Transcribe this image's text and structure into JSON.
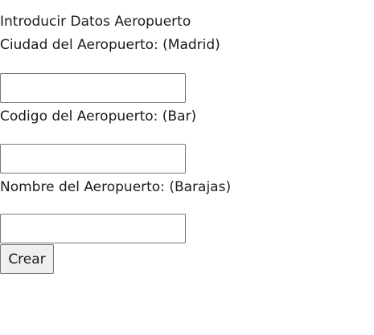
{
  "form": {
    "title": "Introducir Datos Aeropuerto",
    "fields": [
      {
        "label": "Ciudad del Aeropuerto: (Madrid)",
        "value": "",
        "placeholder": ""
      },
      {
        "label": "Codigo del Aeropuerto: (Bar)",
        "value": "",
        "placeholder": ""
      },
      {
        "label": "Nombre del Aeropuerto: (Barajas)",
        "value": "",
        "placeholder": ""
      }
    ],
    "submit_label": "Crear"
  }
}
